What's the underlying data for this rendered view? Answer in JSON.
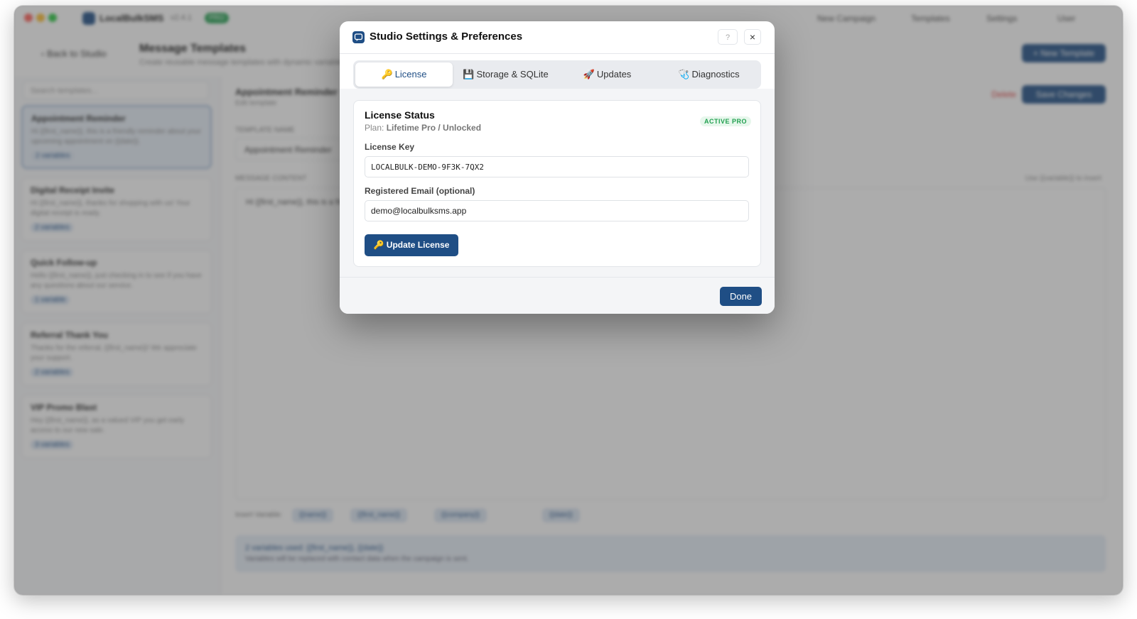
{
  "background": {
    "app_name": "LocalBulkSMS",
    "app_version": "v2.4.1",
    "app_badge": "PRO",
    "topbar": [
      "New Campaign",
      "Templates",
      "Settings",
      "User"
    ],
    "back_label": "Back to Studio",
    "page_title": "Message Templates",
    "page_subtitle": "Create reusable message templates with dynamic variables",
    "new_template_label": "+ New Template",
    "search_placeholder": "Search templates...",
    "templates": [
      {
        "name": "Appointment Reminder",
        "desc": "Hi {{first_name}}, this is a friendly reminder about your upcoming appointment on {{date}}.",
        "tag": "2 variables"
      },
      {
        "name": "Digital Receipt Invite",
        "desc": "Hi {{first_name}}, thanks for shopping with us! Your digital receipt is ready.",
        "tag": "2 variables"
      },
      {
        "name": "Quick Follow-up",
        "desc": "Hello {{first_name}}, just checking in to see if you have any questions about our service.",
        "tag": "1 variable"
      },
      {
        "name": "Referral Thank You",
        "desc": "Thanks for the referral, {{first_name}}! We appreciate your support.",
        "tag": "2 variables"
      },
      {
        "name": "VIP Promo Blast",
        "desc": "Hey {{first_name}}, as a valued VIP you get early access to our new sale.",
        "tag": "3 variables"
      }
    ],
    "main_title": "Appointment Reminder",
    "main_subtitle": "Edit template",
    "delete_label": "Delete",
    "save_label": "Save Changes",
    "label_name": "TEMPLATE NAME",
    "name_value": "Appointment Reminder",
    "label_content": "MESSAGE CONTENT",
    "variables_hint": "Use {{variable}} to insert",
    "editor_text": "Hi {{first_name}}, this is a friendly reminder about your upcoming appointment.",
    "insert_label": "Insert Variable:",
    "chips": [
      "{{name}}",
      "{{first_name}}",
      "{{company}}",
      "{{date}}"
    ],
    "info_title": "2 variables used: {{first_name}}, {{date}}",
    "info_text": "Variables will be replaced with contact data when the campaign is sent."
  },
  "modal": {
    "title": "Studio Settings & Preferences",
    "help_label": "?",
    "close_label": "×",
    "tabs": [
      {
        "icon": "🔑",
        "label": "License",
        "active": true
      },
      {
        "icon": "💾",
        "label": "Storage & SQLite",
        "active": false
      },
      {
        "icon": "🚀",
        "label": "Updates",
        "active": false
      },
      {
        "icon": "🩺",
        "label": "Diagnostics",
        "active": false
      }
    ],
    "license": {
      "status_title": "License Status",
      "plan_prefix": "Plan:",
      "plan_value": "Lifetime Pro / Unlocked",
      "status_badge": "ACTIVE PRO",
      "key_label": "License Key",
      "key_value": "LOCALBULK-DEMO-9F3K-7QX2",
      "email_label": "Registered Email (optional)",
      "email_value": "demo@localbulksms.app",
      "update_label": "🔑 Update License"
    },
    "done_label": "Done"
  },
  "colors": {
    "accent": "#1f4e85",
    "success": "#22a050",
    "success_bg": "#e7f7ec"
  }
}
